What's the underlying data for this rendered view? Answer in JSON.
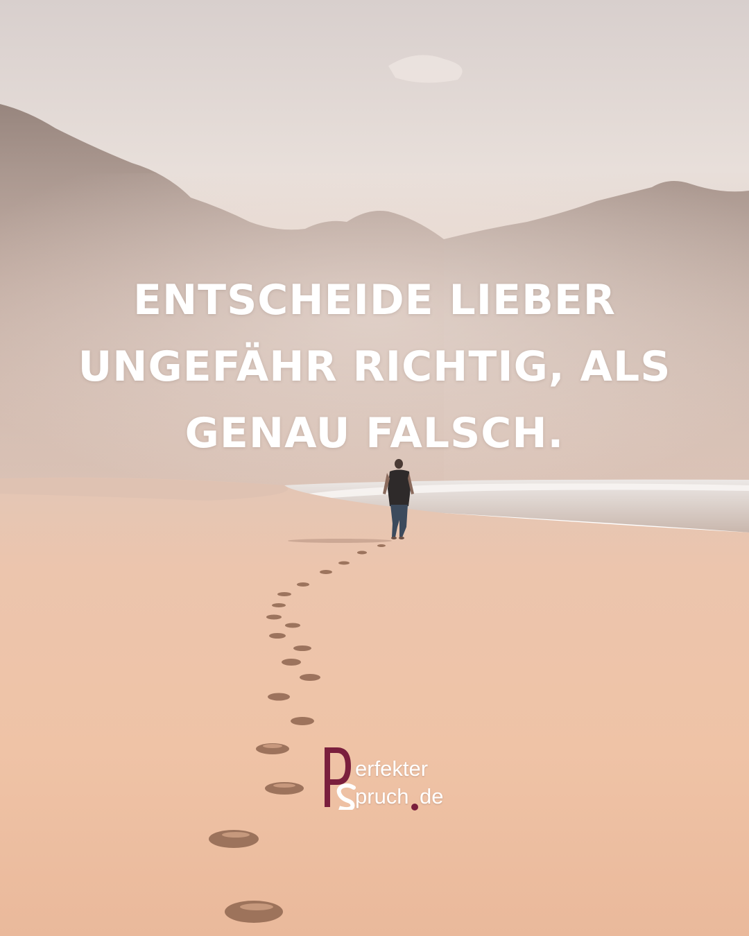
{
  "quote": {
    "lines": [
      "ENTSCHEIDE LIEBER",
      "UNGEFÄHR RICHTIG, ALS",
      "GENAU FALSCH."
    ]
  },
  "logo": {
    "line1": "erfekter",
    "line2": "pruch",
    "domain_suffix": "de",
    "accent_color": "#7a1f3d"
  },
  "colors": {
    "sky": "#e6dbd6",
    "sand": "#eec0a4",
    "mist": "#cbb2a8",
    "quote_text": "#ffffff"
  }
}
